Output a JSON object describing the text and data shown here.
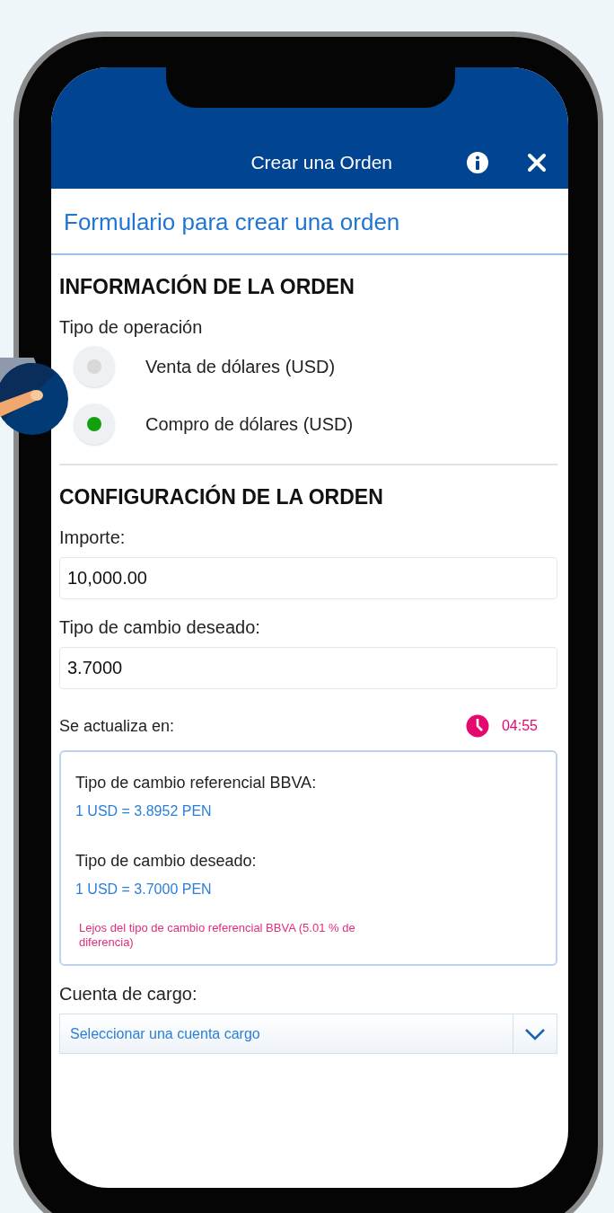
{
  "header": {
    "title": "Crear una Orden"
  },
  "subtitle": "Formulario para crear una orden",
  "order_info": {
    "heading": "INFORMACIÓN DE LA ORDEN",
    "label": "Tipo de operación",
    "options": [
      {
        "label": "Venta de dólares (USD)",
        "selected": false
      },
      {
        "label": "Compro de dólares (USD)",
        "selected": true
      }
    ]
  },
  "order_config": {
    "heading": "CONFIGURACIÓN DE LA ORDEN",
    "fields": [
      {
        "label": "Importe:",
        "value": "10,000.00"
      },
      {
        "label": "Tipo de cambio deseado:",
        "value": "3.7000"
      }
    ],
    "update": {
      "label": "Se actualiza en:",
      "time": "04:55"
    },
    "rates": [
      {
        "label": "Tipo de cambio referencial BBVA:",
        "value": "1 USD = 3.8952 PEN"
      },
      {
        "label": "Tipo de cambio deseado:",
        "value": "1 USD = 3.7000 PEN"
      }
    ],
    "warning": "Lejos del tipo de cambio referencial BBVA (5.01 % de diferencia)"
  },
  "account": {
    "label": "Cuenta de cargo:",
    "placeholder": "Seleccionar una cuenta cargo"
  }
}
